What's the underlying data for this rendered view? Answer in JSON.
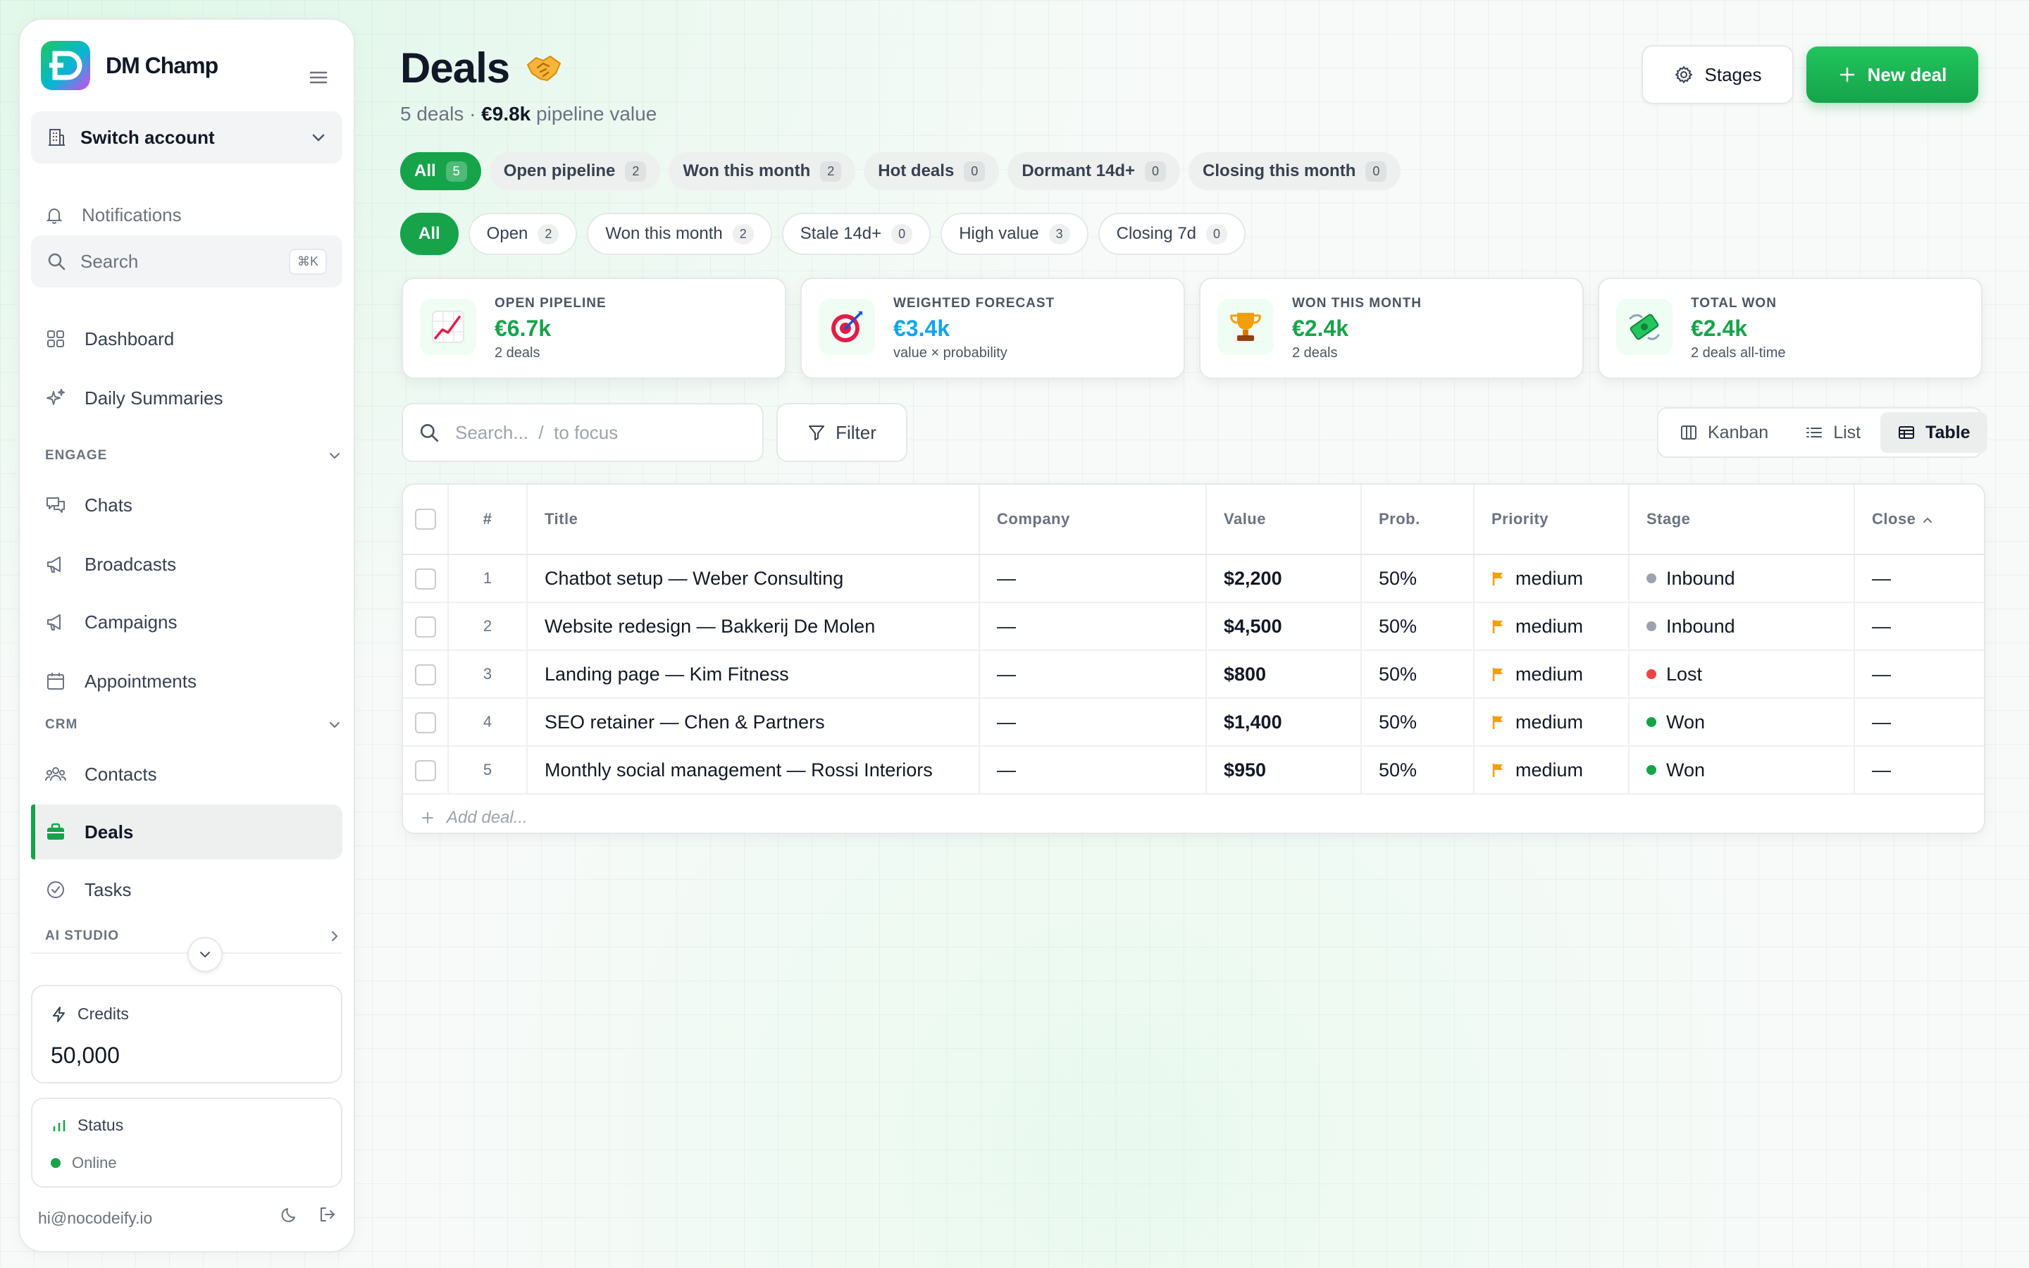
{
  "brand": {
    "name": "DM Champ"
  },
  "sidebar": {
    "switch_account": "Switch account",
    "notifications": "Notifications",
    "search_placeholder": "Search",
    "search_shortcut": "⌘K",
    "items": {
      "dashboard": "Dashboard",
      "daily_summaries": "Daily Summaries",
      "chats": "Chats",
      "broadcasts": "Broadcasts",
      "campaigns": "Campaigns",
      "appointments": "Appointments",
      "contacts": "Contacts",
      "deals": "Deals",
      "tasks": "Tasks"
    },
    "sections": {
      "engage": "ENGAGE",
      "crm": "CRM",
      "ai_studio": "AI STUDIO"
    },
    "credits": {
      "label": "Credits",
      "value": "50,000"
    },
    "status": {
      "label": "Status",
      "value": "Online"
    },
    "footer_email": "hi@nocodeify.io"
  },
  "header": {
    "title": "Deals",
    "title_emoji": "🤝",
    "subtitle_count": "5 deals · ",
    "subtitle_value": "€9.8k",
    "subtitle_suffix": " pipeline value",
    "stages_button": "Stages",
    "new_deal_button": "New deal"
  },
  "saved_views": [
    {
      "label": "All",
      "count": "5",
      "active": true
    },
    {
      "label": "Open pipeline",
      "count": "2"
    },
    {
      "label": "Won this month",
      "count": "2"
    },
    {
      "label": "Hot deals",
      "count": "0"
    },
    {
      "label": "Dormant 14d+",
      "count": "0"
    },
    {
      "label": "Closing this month",
      "count": "0"
    }
  ],
  "quick_filters": [
    {
      "label": "All",
      "active": true
    },
    {
      "label": "Open",
      "count": "2"
    },
    {
      "label": "Won this month",
      "count": "2"
    },
    {
      "label": "Stale 14d+",
      "count": "0"
    },
    {
      "label": "High value",
      "count": "3"
    },
    {
      "label": "Closing 7d",
      "count": "0"
    }
  ],
  "stats": [
    {
      "label": "OPEN PIPELINE",
      "value": "€6.7k",
      "sub": "2 deals",
      "color": "#16a34a",
      "icon": "chart-increasing-icon"
    },
    {
      "label": "WEIGHTED FORECAST",
      "value": "€3.4k",
      "sub": "value × probability",
      "color": "#0ea5e9",
      "icon": "target-icon"
    },
    {
      "label": "WON THIS MONTH",
      "value": "€2.4k",
      "sub": "2 deals",
      "color": "#16a34a",
      "icon": "trophy-icon"
    },
    {
      "label": "TOTAL WON",
      "value": "€2.4k",
      "sub": "2 deals all-time",
      "color": "#16a34a",
      "icon": "money-with-wings-icon"
    }
  ],
  "toolbar": {
    "search_placeholder": "Search...  /  to focus",
    "filter_label": "Filter",
    "views": {
      "kanban": "Kanban",
      "list": "List",
      "table": "Table"
    },
    "active_view": "Table"
  },
  "table": {
    "headers": {
      "num": "#",
      "title": "Title",
      "company": "Company",
      "value": "Value",
      "prob": "Prob.",
      "priority": "Priority",
      "stage": "Stage",
      "close": "Close"
    },
    "rows": [
      {
        "num": "1",
        "title": "Chatbot setup — Weber Consulting",
        "company": "—",
        "value": "$2,200",
        "prob": "50%",
        "priority": "medium",
        "stage": "Inbound",
        "stage_color": "#9ca3af",
        "close": "—"
      },
      {
        "num": "2",
        "title": "Website redesign — Bakkerij De Molen",
        "company": "—",
        "value": "$4,500",
        "prob": "50%",
        "priority": "medium",
        "stage": "Inbound",
        "stage_color": "#9ca3af",
        "close": "—"
      },
      {
        "num": "3",
        "title": "Landing page — Kim Fitness",
        "company": "—",
        "value": "$800",
        "prob": "50%",
        "priority": "medium",
        "stage": "Lost",
        "stage_color": "#ef4444",
        "close": "—"
      },
      {
        "num": "4",
        "title": "SEO retainer — Chen & Partners",
        "company": "—",
        "value": "$1,400",
        "prob": "50%",
        "priority": "medium",
        "stage": "Won",
        "stage_color": "#16a34a",
        "close": "—"
      },
      {
        "num": "5",
        "title": "Monthly social management — Rossi Interiors",
        "company": "—",
        "value": "$950",
        "prob": "50%",
        "priority": "medium",
        "stage": "Won",
        "stage_color": "#16a34a",
        "close": "—"
      }
    ],
    "add_row": "Add deal..."
  },
  "colors": {
    "accent": "#16a34a",
    "priority_flag": "#f59e0b"
  }
}
